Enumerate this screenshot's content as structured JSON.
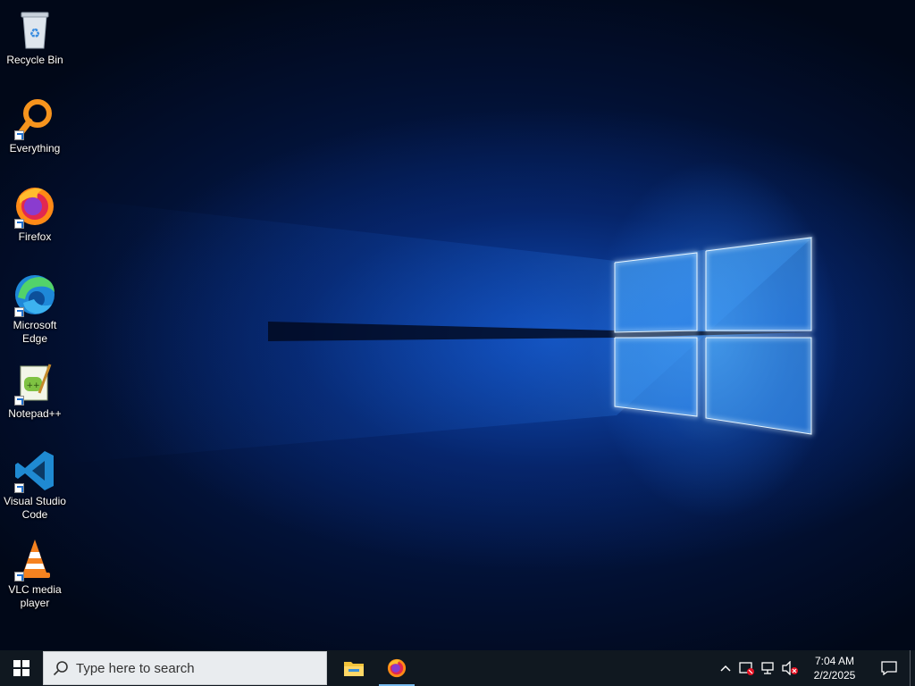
{
  "desktop": {
    "icons": [
      {
        "label": "Recycle Bin",
        "icon": "recycle-bin-icon"
      },
      {
        "label": "Everything",
        "icon": "everything-search-icon"
      },
      {
        "label": "Firefox",
        "icon": "firefox-icon"
      },
      {
        "label": "Microsoft Edge",
        "icon": "edge-icon"
      },
      {
        "label": "Notepad++",
        "icon": "notepad-plus-plus-icon"
      },
      {
        "label": "Visual Studio Code",
        "icon": "vscode-icon"
      },
      {
        "label": "VLC media player",
        "icon": "vlc-icon"
      }
    ]
  },
  "taskbar": {
    "search_placeholder": "Type here to search",
    "pinned": [
      {
        "name": "File Explorer",
        "icon": "file-explorer-icon"
      },
      {
        "name": "Firefox",
        "icon": "firefox-icon",
        "running": true
      }
    ],
    "clock": {
      "time": "7:04 AM",
      "date": "2/2/2025"
    }
  },
  "colors": {
    "accent": "#76b9ed",
    "taskbar": "#101820"
  }
}
